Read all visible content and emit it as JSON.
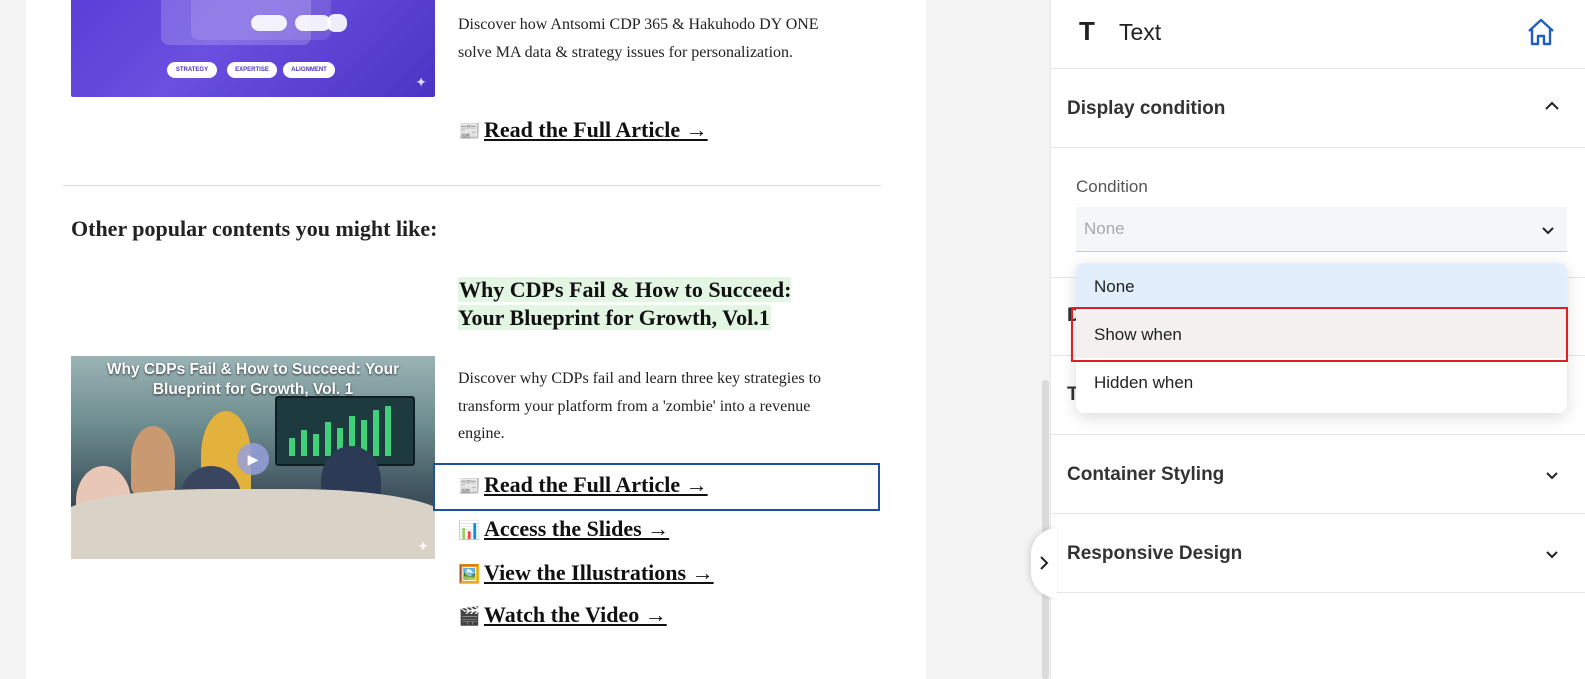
{
  "article_top": {
    "description": "Discover how Antsomi CDP 365 & Hakuhodo DY ONE solve MA data & strategy issues for personalization.",
    "link": {
      "icon": "📰",
      "label": "Read the Full Article →"
    },
    "image_pills": [
      "STRATEGY",
      "EXPERTISE",
      "ALIGNMENT"
    ]
  },
  "section_title": "Other popular contents you might like:",
  "article_main": {
    "headline": "Why CDPs Fail & How to Succeed: Your Blueprint for Growth, Vol.1",
    "image_caption": "Why CDPs Fail & How to Succeed: Your Blueprint for Growth, Vol. 1",
    "description": "Discover why CDPs fail and learn three key strategies to transform your platform from a 'zombie' into a revenue engine.",
    "links": [
      {
        "icon": "📰",
        "label": "Read the Full Article →"
      },
      {
        "icon": "📊",
        "label": "Access the Slides →"
      },
      {
        "icon": "🖼️",
        "label": "View the Illustrations →"
      },
      {
        "icon": "🎬",
        "label": "Watch the Video →"
      }
    ]
  },
  "panel": {
    "title": "Text",
    "display_condition": {
      "label": "Display condition",
      "field_label": "Condition",
      "selected": "None",
      "options": [
        "None",
        "Show when",
        "Hidden when"
      ]
    },
    "sections": [
      "Container Styling",
      "Responsive Design"
    ]
  },
  "colors": {
    "accent_blue": "#1f4fa3",
    "highlight_red": "#e02020",
    "headline_bg": "#e3f5e3"
  }
}
